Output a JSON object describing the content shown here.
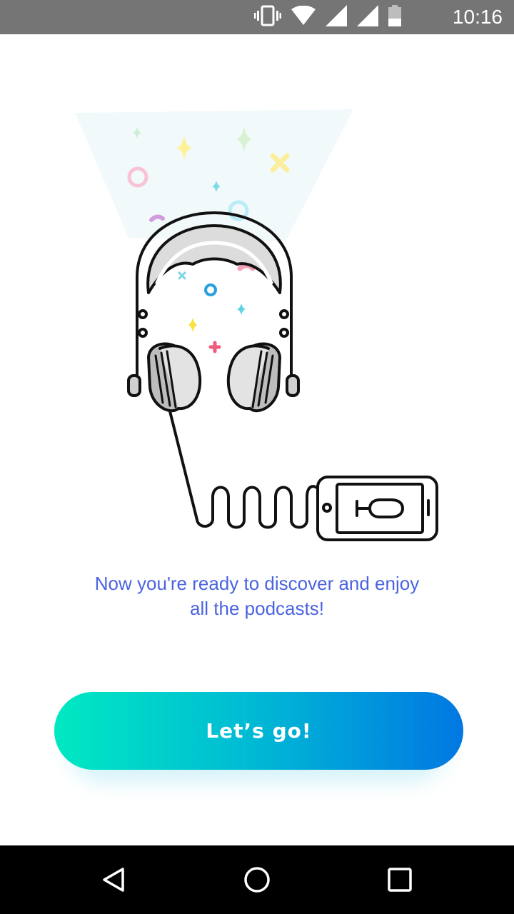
{
  "status_bar": {
    "time": "10:16",
    "icons": [
      "vibrate-icon",
      "wifi-icon",
      "signal-icon",
      "signal-icon",
      "battery-icon"
    ],
    "color": "#757575"
  },
  "illustration": {
    "icons": [
      "headphones-icon",
      "phone-icon",
      "podcast-microphone-icon",
      "confetti-icon"
    ]
  },
  "onboarding": {
    "message_line1": "Now you're ready to discover and enjoy",
    "message_line2": "all the podcasts!",
    "message_color": "#4b63e0"
  },
  "cta": {
    "label": "Let’s go!",
    "gradient_start": "#00e9c2",
    "gradient_end": "#0177e2"
  },
  "nav_bar": {
    "buttons": [
      "back-icon",
      "home-icon",
      "recents-icon"
    ]
  }
}
